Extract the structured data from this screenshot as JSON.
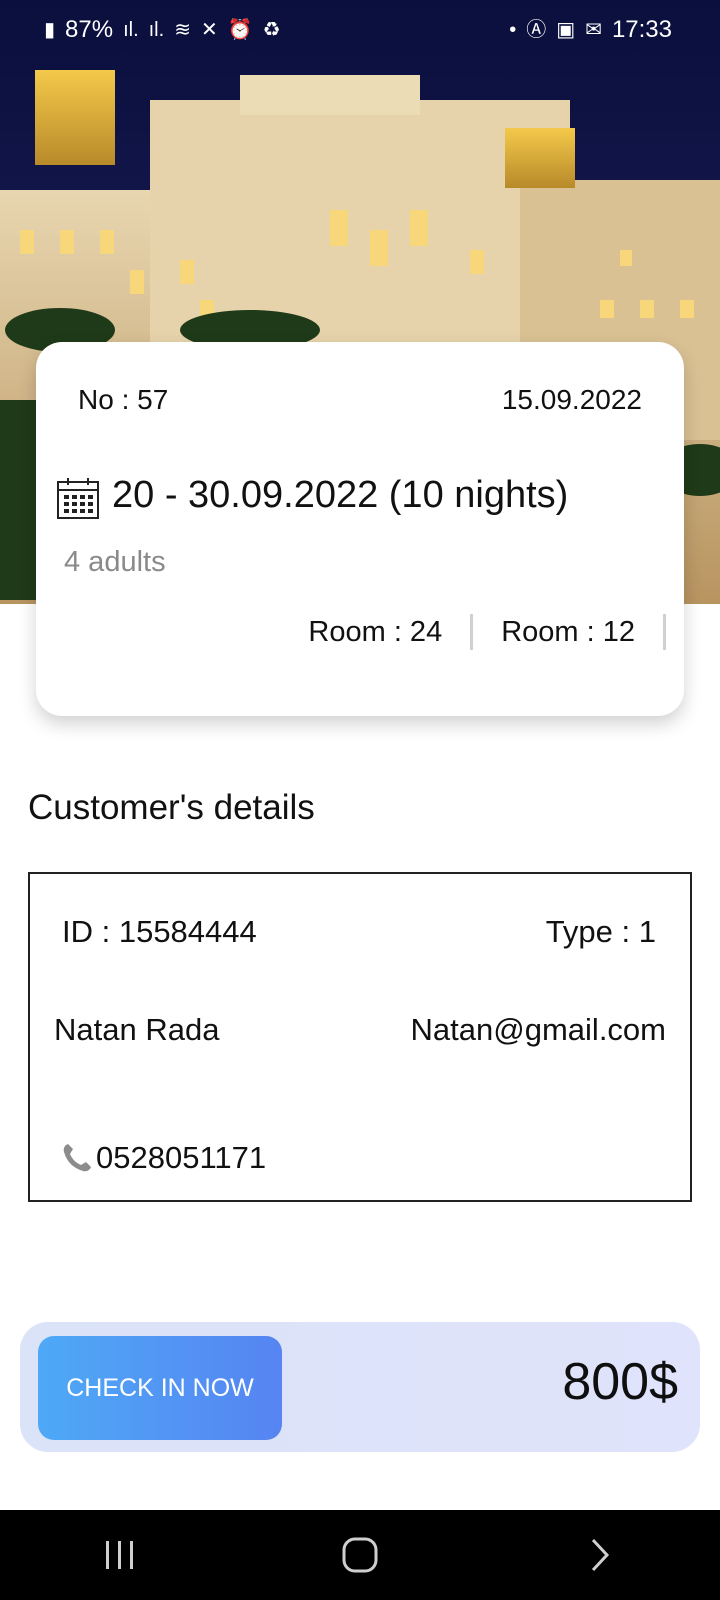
{
  "status_bar": {
    "battery": "87%",
    "time": "17:33"
  },
  "hero": {
    "image": "hotel-palace-night"
  },
  "booking": {
    "number_label": "No : 57",
    "booking_date": "15.09.2022",
    "stay_range": "20 - 30.09.2022 (10 nights)",
    "guests": "4 adults",
    "rooms": [
      "Room : 24",
      "Room : 12"
    ]
  },
  "customer": {
    "section_title": "Customer's details",
    "id_label": "ID : 15584444",
    "type_label": "Type : 1",
    "name": "Natan Rada",
    "email": "Natan@gmail.com",
    "phone": "0528051171"
  },
  "checkout": {
    "button_label": "CHECK IN NOW",
    "price": "800$"
  },
  "nav": {
    "icons": [
      "recent-apps-icon",
      "home-icon",
      "back-icon"
    ]
  },
  "colors": {
    "button_start": "#4ea9f6",
    "button_end": "#5684f2",
    "bar_bg": "#dbe3f8",
    "muted_text": "#8a8a8a"
  }
}
